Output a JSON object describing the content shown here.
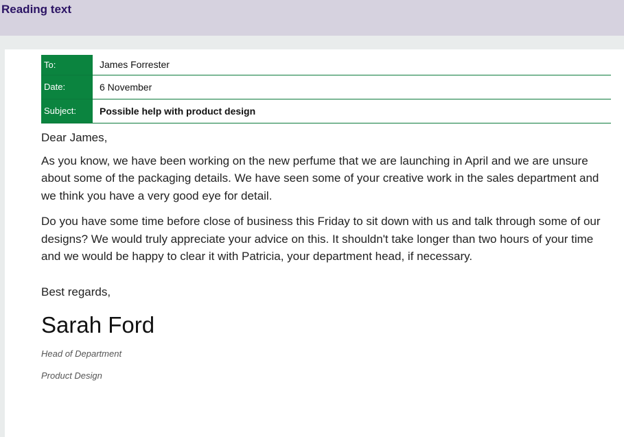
{
  "header": {
    "title": "Reading text"
  },
  "memo": {
    "to_label": "To:",
    "to_value": "James Forrester",
    "date_label": "Date:",
    "date_value": "6 November",
    "subject_label": "Subject:",
    "subject_value": "Possible help with product design"
  },
  "letter": {
    "greeting": "Dear James,",
    "paragraph1": "As you know, we have been working on the new perfume that we are launching in April and we are unsure about some of the packaging details. We have seen some of your creative work in the sales department and we think you have a very good eye for detail.",
    "paragraph2": "Do you have some time before close of business this Friday to sit down with us and talk through some of our designs? We would truly appreciate your advice on this. It shouldn't take longer than two hours of your time and we would be happy to clear it with Patricia, your department head, if necessary.",
    "closing": "Best regards,",
    "signature": "Sarah Ford",
    "sender_title_line1": "Head of Department",
    "sender_title_line2": "Product Design"
  },
  "colors": {
    "header_bg": "#d6d2df",
    "header_text": "#2b1464",
    "memo_label_bg": "#0b843f",
    "memo_rule": "#0b7a3b"
  }
}
